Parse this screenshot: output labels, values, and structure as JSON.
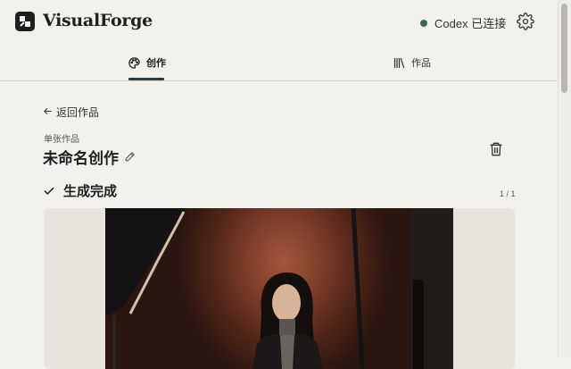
{
  "app": {
    "brand_name": "VisualForge",
    "connection_status": "Codex 已连接",
    "status_color": "#2f6b4c"
  },
  "tabs": [
    {
      "label": "创作",
      "icon": "palette-icon",
      "active": true
    },
    {
      "label": "作品",
      "icon": "library-icon",
      "active": false
    }
  ],
  "page": {
    "back_label": "返回作品",
    "type_label": "单张作品",
    "title": "未命名创作",
    "generation_status": "生成完成",
    "image_counter": "1 / 1"
  },
  "colors": {
    "accent": "#2d3a4a",
    "background": "#f3f1ec"
  }
}
